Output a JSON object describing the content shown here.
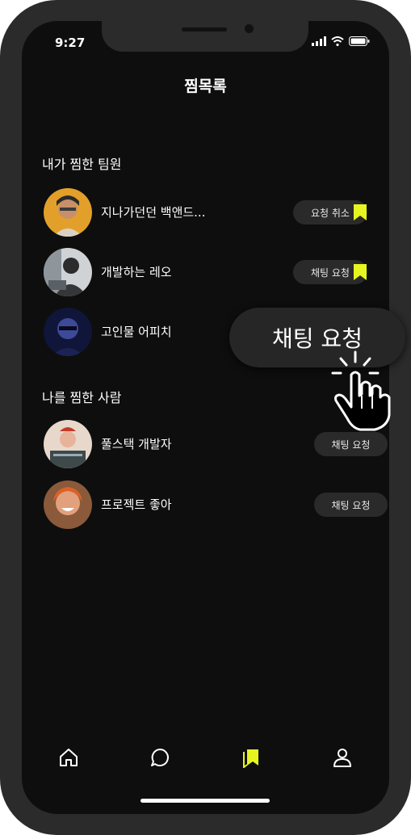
{
  "status_bar": {
    "time": "9:27"
  },
  "header": {
    "title": "찜목록"
  },
  "my_picks": {
    "heading": "내가 찜한 팀원",
    "items": [
      {
        "name": "지나가던던 백앤드...",
        "action": "요청 취소",
        "bookmarked": true
      },
      {
        "name": "개발하는 레오",
        "action": "채팅 요청",
        "bookmarked": true
      },
      {
        "name": "고인물 어피치"
      }
    ]
  },
  "picked_me": {
    "heading": "나를 찜한 사람",
    "items": [
      {
        "name": "풀스택 개발자",
        "action": "채팅 요청"
      },
      {
        "name": "프로젝트 좋아",
        "action": "채팅 요청"
      }
    ]
  },
  "tooltip": {
    "label": "채팅 요청"
  },
  "bottom_nav": {
    "items": [
      {
        "icon": "home-icon",
        "active": false
      },
      {
        "icon": "chat-icon",
        "active": false
      },
      {
        "icon": "bookmark-icon",
        "active": true
      },
      {
        "icon": "user-icon",
        "active": false
      }
    ]
  },
  "colors": {
    "accent": "#e6f520",
    "background": "#0e0e0e",
    "pill": "#2a2a2a"
  }
}
